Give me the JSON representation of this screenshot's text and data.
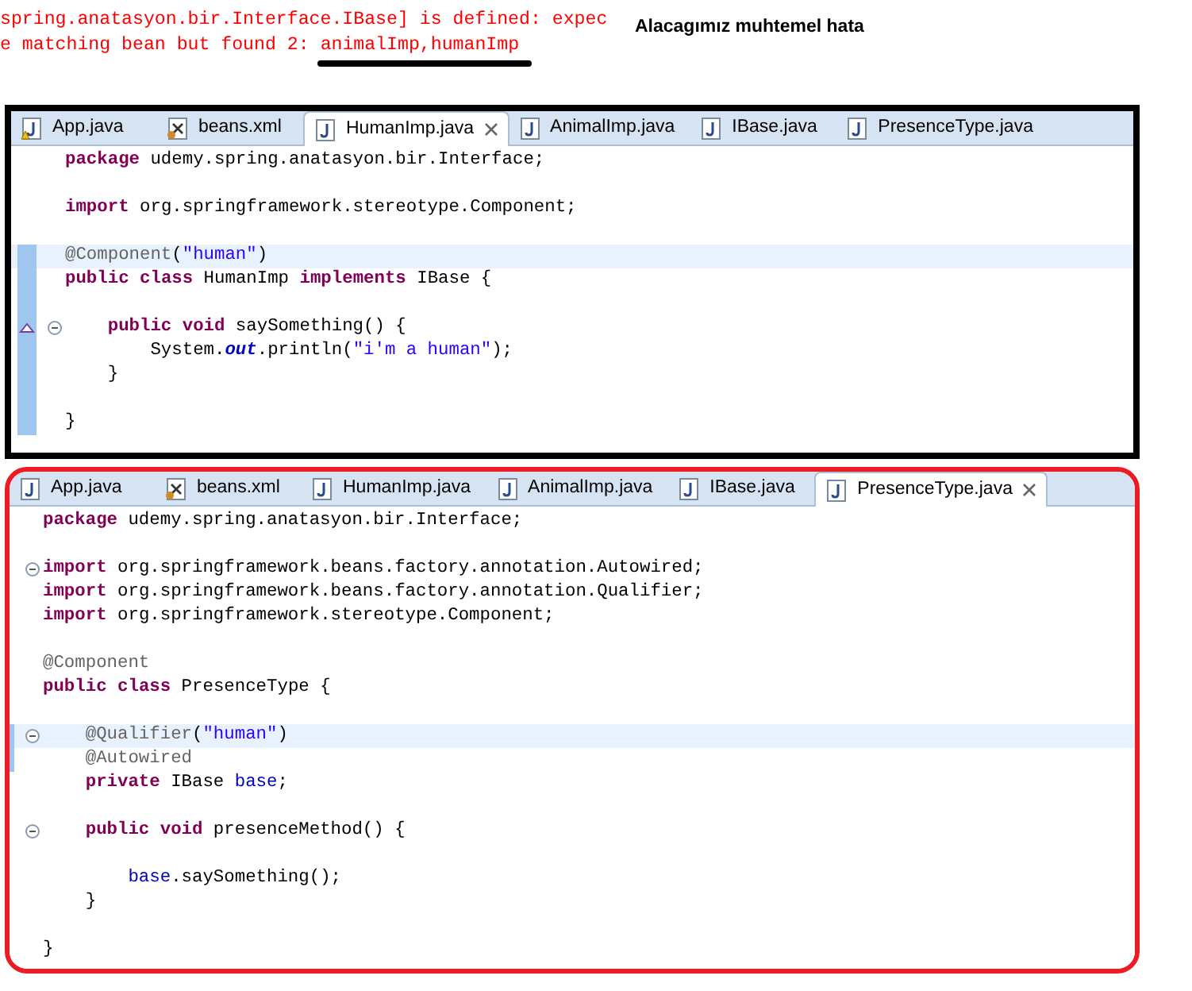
{
  "error_output": {
    "lines": [
      {
        "segments": [
          {
            "text": "spring.anatasyon.bir.Interface.IBase] is defined: expec",
            "underlined": false
          }
        ]
      },
      {
        "segments": [
          {
            "text": "e matching bean but found 2:",
            "underlined": false
          },
          {
            "text": "animalImp,humanImp",
            "underlined": true
          }
        ]
      }
    ],
    "note": "Alacagımız muhtemel hata"
  },
  "editors": [
    {
      "color": "#000000",
      "tabs": [
        {
          "label": "App.java",
          "kind": "java-warning",
          "selected": false
        },
        {
          "label": "beans.xml",
          "kind": "xml",
          "selected": false
        },
        {
          "label": "HumanImp.java",
          "kind": "java",
          "selected": true
        },
        {
          "label": "AnimalImp.java",
          "kind": "java",
          "selected": false
        },
        {
          "label": "IBase.java",
          "kind": "java",
          "selected": false
        },
        {
          "label": "PresenceType.java",
          "kind": "java",
          "selected": false
        }
      ],
      "lines": [
        {
          "tokens": [
            {
              "text": "package",
              "kind": "keyword"
            },
            {
              "text": " udemy.spring.anatasyon.bir.Interface;",
              "kind": "plain"
            }
          ],
          "highlighted": false,
          "fold": false,
          "changed": false,
          "override": false
        },
        {
          "highlighted": false,
          "fold": false,
          "changed": false,
          "override": false
        },
        {
          "tokens": [
            {
              "text": "import",
              "kind": "keyword"
            },
            {
              "text": " org.springframework.stereotype.Component;",
              "kind": "plain"
            }
          ],
          "highlighted": false,
          "fold": false,
          "changed": false,
          "override": false
        },
        {
          "highlighted": false,
          "fold": false,
          "changed": false,
          "override": false
        },
        {
          "tokens": [
            {
              "text": "@Component",
              "kind": "annotation"
            },
            {
              "text": "(",
              "kind": "plain"
            },
            {
              "text": "\"human\"",
              "kind": "string"
            },
            {
              "text": ")",
              "kind": "plain"
            }
          ],
          "highlighted": true,
          "fold": false,
          "changed": true,
          "override": false
        },
        {
          "tokens": [
            {
              "text": "public",
              "kind": "keyword"
            },
            {
              "text": " class",
              "kind": "keyword"
            },
            {
              "text": " HumanImp",
              "kind": "plain"
            },
            {
              "text": " implements",
              "kind": "keyword"
            },
            {
              "text": " IBase {",
              "kind": "plain"
            }
          ],
          "highlighted": false,
          "fold": false,
          "changed": true,
          "override": false
        },
        {
          "highlighted": false,
          "fold": false,
          "changed": true,
          "override": false
        },
        {
          "tokens": [
            {
              "text": "    public",
              "kind": "keyword"
            },
            {
              "text": " void",
              "kind": "keyword"
            },
            {
              "text": " saySomething() {",
              "kind": "plain"
            }
          ],
          "highlighted": false,
          "fold": true,
          "changed": true,
          "override": true
        },
        {
          "tokens": [
            {
              "text": "        System.",
              "kind": "plain"
            },
            {
              "text": "out",
              "kind": "static-field"
            },
            {
              "text": ".println(",
              "kind": "plain"
            },
            {
              "text": "\"i'm a human\"",
              "kind": "string"
            },
            {
              "text": ");",
              "kind": "plain"
            }
          ],
          "highlighted": false,
          "fold": false,
          "changed": true,
          "override": false
        },
        {
          "tokens": [
            {
              "text": "    }",
              "kind": "plain"
            }
          ],
          "highlighted": false,
          "fold": false,
          "changed": true,
          "override": false
        },
        {
          "highlighted": false,
          "fold": false,
          "changed": true,
          "override": false
        },
        {
          "tokens": [
            {
              "text": "}",
              "kind": "plain"
            }
          ],
          "highlighted": false,
          "fold": false,
          "changed": true,
          "override": false
        }
      ]
    },
    {
      "color": "#ed1c24",
      "tabs": [
        {
          "label": "App.java",
          "kind": "java",
          "selected": false
        },
        {
          "label": "beans.xml",
          "kind": "xml",
          "selected": false
        },
        {
          "label": "HumanImp.java",
          "kind": "java",
          "selected": false
        },
        {
          "label": "AnimalImp.java",
          "kind": "java",
          "selected": false
        },
        {
          "label": "IBase.java",
          "kind": "java",
          "selected": false
        },
        {
          "label": "PresenceType.java",
          "kind": "java",
          "selected": true
        }
      ],
      "lines": [
        {
          "tokens": [
            {
              "text": "package",
              "kind": "keyword"
            },
            {
              "text": " udemy.spring.anatasyon.bir.Interface;",
              "kind": "plain"
            }
          ],
          "highlighted": false,
          "fold": false,
          "changed": false,
          "override": false
        },
        {
          "highlighted": false,
          "fold": false,
          "changed": false,
          "override": false
        },
        {
          "tokens": [
            {
              "text": "import",
              "kind": "keyword"
            },
            {
              "text": " org.springframework.beans.factory.annotation.Autowired;",
              "kind": "plain"
            }
          ],
          "highlighted": false,
          "fold": true,
          "changed": false,
          "override": false
        },
        {
          "tokens": [
            {
              "text": "import",
              "kind": "keyword"
            },
            {
              "text": " org.springframework.beans.factory.annotation.Qualifier;",
              "kind": "plain"
            }
          ],
          "highlighted": false,
          "fold": false,
          "changed": false,
          "override": false
        },
        {
          "tokens": [
            {
              "text": "import",
              "kind": "keyword"
            },
            {
              "text": " org.springframework.stereotype.Component;",
              "kind": "plain"
            }
          ],
          "highlighted": false,
          "fold": false,
          "changed": false,
          "override": false
        },
        {
          "highlighted": false,
          "fold": false,
          "changed": false,
          "override": false
        },
        {
          "tokens": [
            {
              "text": "@Component",
              "kind": "annotation"
            }
          ],
          "highlighted": false,
          "fold": false,
          "changed": false,
          "override": false
        },
        {
          "tokens": [
            {
              "text": "public",
              "kind": "keyword"
            },
            {
              "text": " class",
              "kind": "keyword"
            },
            {
              "text": " PresenceType {",
              "kind": "plain"
            }
          ],
          "highlighted": false,
          "fold": false,
          "changed": false,
          "override": false
        },
        {
          "highlighted": false,
          "fold": false,
          "changed": false,
          "override": false
        },
        {
          "tokens": [
            {
              "text": "    @Qualifier",
              "kind": "annotation"
            },
            {
              "text": "(",
              "kind": "plain"
            },
            {
              "text": "\"human\"",
              "kind": "string"
            },
            {
              "text": ")",
              "kind": "plain"
            }
          ],
          "highlighted": true,
          "fold": true,
          "changed": true,
          "override": false
        },
        {
          "tokens": [
            {
              "text": "    @Autowired",
              "kind": "annotation"
            }
          ],
          "highlighted": false,
          "fold": false,
          "changed": true,
          "override": false
        },
        {
          "tokens": [
            {
              "text": "    private",
              "kind": "keyword"
            },
            {
              "text": " IBase",
              "kind": "plain"
            },
            {
              "text": " base",
              "kind": "field"
            },
            {
              "text": ";",
              "kind": "plain"
            }
          ],
          "highlighted": false,
          "fold": false,
          "changed": false,
          "override": false
        },
        {
          "highlighted": false,
          "fold": false,
          "changed": false,
          "override": false
        },
        {
          "tokens": [
            {
              "text": "    public",
              "kind": "keyword"
            },
            {
              "text": " void",
              "kind": "keyword"
            },
            {
              "text": " presenceMethod() {",
              "kind": "plain"
            }
          ],
          "highlighted": false,
          "fold": true,
          "changed": false,
          "override": false
        },
        {
          "highlighted": false,
          "fold": false,
          "changed": false,
          "override": false
        },
        {
          "tokens": [
            {
              "text": "        base",
              "kind": "field"
            },
            {
              "text": ".saySomething();",
              "kind": "plain"
            }
          ],
          "highlighted": false,
          "fold": false,
          "changed": false,
          "override": false
        },
        {
          "tokens": [
            {
              "text": "    }",
              "kind": "plain"
            }
          ],
          "highlighted": false,
          "fold": false,
          "changed": false,
          "override": false
        },
        {
          "highlighted": false,
          "fold": false,
          "changed": false,
          "override": false
        },
        {
          "tokens": [
            {
              "text": "}",
              "kind": "plain"
            }
          ],
          "highlighted": false,
          "fold": false,
          "changed": false,
          "override": false
        }
      ]
    }
  ]
}
